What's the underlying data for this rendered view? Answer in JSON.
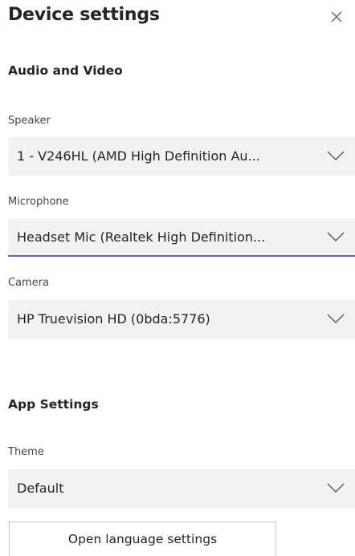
{
  "dialog": {
    "title": "Device settings"
  },
  "audio_video": {
    "heading": "Audio and Video",
    "speaker": {
      "label": "Speaker",
      "value": "1 - V246HL (AMD High Definition Au..."
    },
    "microphone": {
      "label": "Microphone",
      "value": "Headset Mic (Realtek High Definition..."
    },
    "camera": {
      "label": "Camera",
      "value": "HP Truevision HD (0bda:5776)"
    }
  },
  "app_settings": {
    "heading": "App Settings",
    "theme": {
      "label": "Theme",
      "value": "Default"
    },
    "language_button_label": "Open language settings"
  },
  "icons": {
    "close": "close-icon",
    "dropdown": "chevron-down-icon"
  },
  "colors": {
    "accent": "#6264a7",
    "select_bg": "#f3f2f1",
    "text": "#252423"
  }
}
